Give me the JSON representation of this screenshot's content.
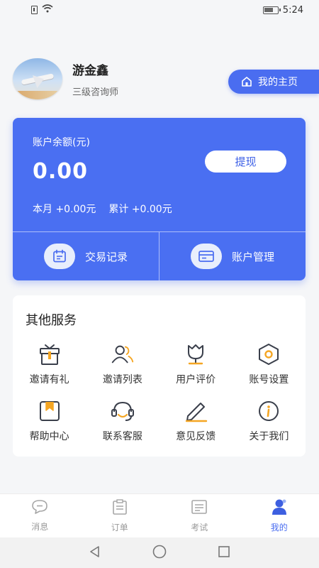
{
  "status_bar": {
    "time": "5:24"
  },
  "profile": {
    "name": "游金鑫",
    "title": "三级咨询师",
    "home_button": "我的主页"
  },
  "account": {
    "balance_label": "账户余额(元)",
    "balance": "0.00",
    "withdraw_label": "提现",
    "month_label": "本月",
    "month_value": "+0.00元",
    "total_label": "累计",
    "total_value": "+0.00元",
    "actions": [
      "交易记录",
      "账户管理"
    ]
  },
  "services": {
    "title": "其他服务",
    "items": [
      {
        "label": "邀请有礼",
        "icon": "gift-icon"
      },
      {
        "label": "邀请列表",
        "icon": "users-icon"
      },
      {
        "label": "用户评价",
        "icon": "tulip-icon"
      },
      {
        "label": "账号设置",
        "icon": "hexagon-settings-icon"
      },
      {
        "label": "帮助中心",
        "icon": "bookmark-book-icon"
      },
      {
        "label": "联系客服",
        "icon": "headset-icon"
      },
      {
        "label": "意见反馈",
        "icon": "pen-icon"
      },
      {
        "label": "关于我们",
        "icon": "info-icon"
      }
    ]
  },
  "bottom_nav": {
    "items": [
      {
        "label": "消息",
        "icon": "chat-icon",
        "active": false
      },
      {
        "label": "订单",
        "icon": "clipboard-icon",
        "active": false
      },
      {
        "label": "考试",
        "icon": "exam-icon",
        "active": false
      },
      {
        "label": "我的",
        "icon": "person-icon",
        "active": true
      }
    ]
  },
  "colors": {
    "primary": "#4a6df0",
    "accent": "#f5a623",
    "icon_dark": "#3a3f4b"
  }
}
